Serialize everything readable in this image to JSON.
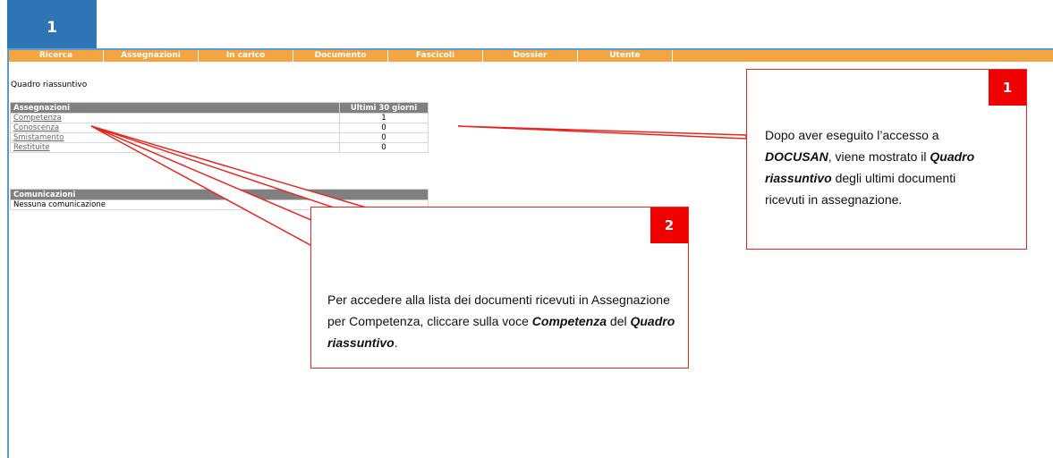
{
  "step_badge": "1",
  "nav": {
    "items": [
      "Ricerca",
      "Assegnazioni",
      "In carico",
      "Documento",
      "Fascicoli",
      "Dossier",
      "Utente"
    ]
  },
  "summary": {
    "title": "Quadro riassuntivo",
    "assignments": {
      "header_label": "Assegnazioni",
      "header_period": "Ultimi 30 giorni",
      "rows": [
        {
          "label": "Competenza",
          "count": "1"
        },
        {
          "label": "Conoscenza",
          "count": "0"
        },
        {
          "label": "Smistamento",
          "count": "0"
        },
        {
          "label": "Restituite",
          "count": "0"
        }
      ]
    },
    "communications": {
      "header_label": "Comunicazioni",
      "empty_text": "Nessuna comunicazione"
    }
  },
  "callouts": {
    "one": {
      "badge": "1",
      "t1": "Dopo aver eseguito l’accesso a",
      "t2": "DOCUSAN",
      "t3": ", viene mostrato il",
      "t4": "Quadro riassuntivo",
      "t5": " degli ultimi documenti ricevuti in assegnazione."
    },
    "two": {
      "badge": "2",
      "t1": "Per accedere alla lista dei documenti ricevuti in Assegnazione per Competenza, cliccare sulla voce ",
      "t2": "Competenza",
      "t3": " del ",
      "t4": "Quadro riassuntivo",
      "t5": "."
    }
  },
  "colors": {
    "nav_bar": "#f4a441",
    "step_tab": "#2e75b6",
    "callout_border": "#e8261f",
    "callout_badge": "#f00000",
    "table_header": "#808080"
  }
}
